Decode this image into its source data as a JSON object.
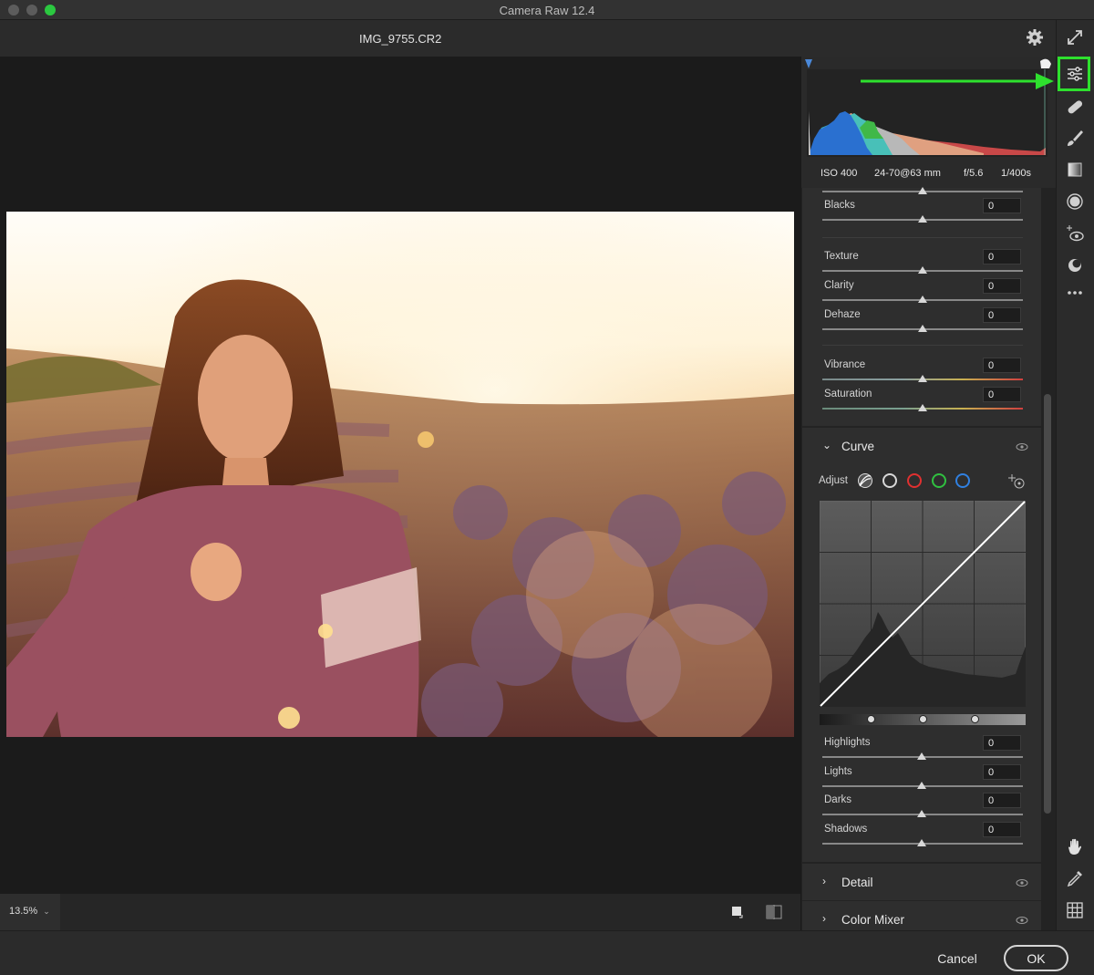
{
  "window": {
    "title": "Camera Raw 12.4"
  },
  "header": {
    "filename": "IMG_9755.CR2"
  },
  "exif": {
    "iso": "ISO 400",
    "lens": "24-70@63 mm",
    "aperture": "f/5.6",
    "shutter": "1/400s"
  },
  "basic": {
    "blacks": {
      "label": "Blacks",
      "value": "0"
    },
    "texture": {
      "label": "Texture",
      "value": "0"
    },
    "clarity": {
      "label": "Clarity",
      "value": "0"
    },
    "dehaze": {
      "label": "Dehaze",
      "value": "0"
    },
    "vibrance": {
      "label": "Vibrance",
      "value": "0"
    },
    "saturation": {
      "label": "Saturation",
      "value": "0"
    }
  },
  "curve": {
    "title": "Curve",
    "adjust_label": "Adjust",
    "highlights": {
      "label": "Highlights",
      "value": "0"
    },
    "lights": {
      "label": "Lights",
      "value": "0"
    },
    "darks": {
      "label": "Darks",
      "value": "0"
    },
    "shadows": {
      "label": "Shadows",
      "value": "0"
    }
  },
  "sections": {
    "detail": "Detail",
    "color_mixer": "Color Mixer"
  },
  "view": {
    "zoom": "13.5%"
  },
  "footer": {
    "cancel": "Cancel",
    "ok": "OK"
  },
  "colors": {
    "annotation_green": "#2ee02e",
    "panel_bg": "#2e2e2e",
    "canvas_bg": "#1b1b1b"
  },
  "icons": [
    "settings-gear-icon",
    "fullscreen-icon",
    "edit-sliders-icon",
    "healing-icon",
    "brush-icon",
    "linear-gradient-icon",
    "radial-filter-icon",
    "red-eye-icon",
    "presets-icon",
    "more-icon",
    "hand-icon",
    "eyedropper-icon",
    "grid-icon"
  ]
}
